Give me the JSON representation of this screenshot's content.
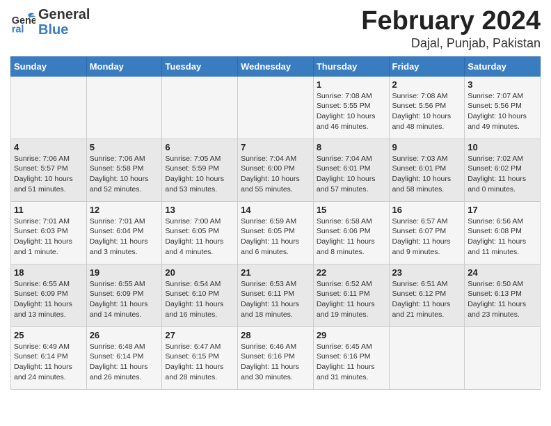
{
  "header": {
    "logo_general": "General",
    "logo_blue": "Blue",
    "title": "February 2024",
    "subtitle": "Dajal, Punjab, Pakistan"
  },
  "weekdays": [
    "Sunday",
    "Monday",
    "Tuesday",
    "Wednesday",
    "Thursday",
    "Friday",
    "Saturday"
  ],
  "weeks": [
    [
      {
        "day": "",
        "info": ""
      },
      {
        "day": "",
        "info": ""
      },
      {
        "day": "",
        "info": ""
      },
      {
        "day": "",
        "info": ""
      },
      {
        "day": "1",
        "info": "Sunrise: 7:08 AM\nSunset: 5:55 PM\nDaylight: 10 hours\nand 46 minutes."
      },
      {
        "day": "2",
        "info": "Sunrise: 7:08 AM\nSunset: 5:56 PM\nDaylight: 10 hours\nand 48 minutes."
      },
      {
        "day": "3",
        "info": "Sunrise: 7:07 AM\nSunset: 5:56 PM\nDaylight: 10 hours\nand 49 minutes."
      }
    ],
    [
      {
        "day": "4",
        "info": "Sunrise: 7:06 AM\nSunset: 5:57 PM\nDaylight: 10 hours\nand 51 minutes."
      },
      {
        "day": "5",
        "info": "Sunrise: 7:06 AM\nSunset: 5:58 PM\nDaylight: 10 hours\nand 52 minutes."
      },
      {
        "day": "6",
        "info": "Sunrise: 7:05 AM\nSunset: 5:59 PM\nDaylight: 10 hours\nand 53 minutes."
      },
      {
        "day": "7",
        "info": "Sunrise: 7:04 AM\nSunset: 6:00 PM\nDaylight: 10 hours\nand 55 minutes."
      },
      {
        "day": "8",
        "info": "Sunrise: 7:04 AM\nSunset: 6:01 PM\nDaylight: 10 hours\nand 57 minutes."
      },
      {
        "day": "9",
        "info": "Sunrise: 7:03 AM\nSunset: 6:01 PM\nDaylight: 10 hours\nand 58 minutes."
      },
      {
        "day": "10",
        "info": "Sunrise: 7:02 AM\nSunset: 6:02 PM\nDaylight: 11 hours\nand 0 minutes."
      }
    ],
    [
      {
        "day": "11",
        "info": "Sunrise: 7:01 AM\nSunset: 6:03 PM\nDaylight: 11 hours\nand 1 minute."
      },
      {
        "day": "12",
        "info": "Sunrise: 7:01 AM\nSunset: 6:04 PM\nDaylight: 11 hours\nand 3 minutes."
      },
      {
        "day": "13",
        "info": "Sunrise: 7:00 AM\nSunset: 6:05 PM\nDaylight: 11 hours\nand 4 minutes."
      },
      {
        "day": "14",
        "info": "Sunrise: 6:59 AM\nSunset: 6:05 PM\nDaylight: 11 hours\nand 6 minutes."
      },
      {
        "day": "15",
        "info": "Sunrise: 6:58 AM\nSunset: 6:06 PM\nDaylight: 11 hours\nand 8 minutes."
      },
      {
        "day": "16",
        "info": "Sunrise: 6:57 AM\nSunset: 6:07 PM\nDaylight: 11 hours\nand 9 minutes."
      },
      {
        "day": "17",
        "info": "Sunrise: 6:56 AM\nSunset: 6:08 PM\nDaylight: 11 hours\nand 11 minutes."
      }
    ],
    [
      {
        "day": "18",
        "info": "Sunrise: 6:55 AM\nSunset: 6:09 PM\nDaylight: 11 hours\nand 13 minutes."
      },
      {
        "day": "19",
        "info": "Sunrise: 6:55 AM\nSunset: 6:09 PM\nDaylight: 11 hours\nand 14 minutes."
      },
      {
        "day": "20",
        "info": "Sunrise: 6:54 AM\nSunset: 6:10 PM\nDaylight: 11 hours\nand 16 minutes."
      },
      {
        "day": "21",
        "info": "Sunrise: 6:53 AM\nSunset: 6:11 PM\nDaylight: 11 hours\nand 18 minutes."
      },
      {
        "day": "22",
        "info": "Sunrise: 6:52 AM\nSunset: 6:11 PM\nDaylight: 11 hours\nand 19 minutes."
      },
      {
        "day": "23",
        "info": "Sunrise: 6:51 AM\nSunset: 6:12 PM\nDaylight: 11 hours\nand 21 minutes."
      },
      {
        "day": "24",
        "info": "Sunrise: 6:50 AM\nSunset: 6:13 PM\nDaylight: 11 hours\nand 23 minutes."
      }
    ],
    [
      {
        "day": "25",
        "info": "Sunrise: 6:49 AM\nSunset: 6:14 PM\nDaylight: 11 hours\nand 24 minutes."
      },
      {
        "day": "26",
        "info": "Sunrise: 6:48 AM\nSunset: 6:14 PM\nDaylight: 11 hours\nand 26 minutes."
      },
      {
        "day": "27",
        "info": "Sunrise: 6:47 AM\nSunset: 6:15 PM\nDaylight: 11 hours\nand 28 minutes."
      },
      {
        "day": "28",
        "info": "Sunrise: 6:46 AM\nSunset: 6:16 PM\nDaylight: 11 hours\nand 30 minutes."
      },
      {
        "day": "29",
        "info": "Sunrise: 6:45 AM\nSunset: 6:16 PM\nDaylight: 11 hours\nand 31 minutes."
      },
      {
        "day": "",
        "info": ""
      },
      {
        "day": "",
        "info": ""
      }
    ]
  ]
}
